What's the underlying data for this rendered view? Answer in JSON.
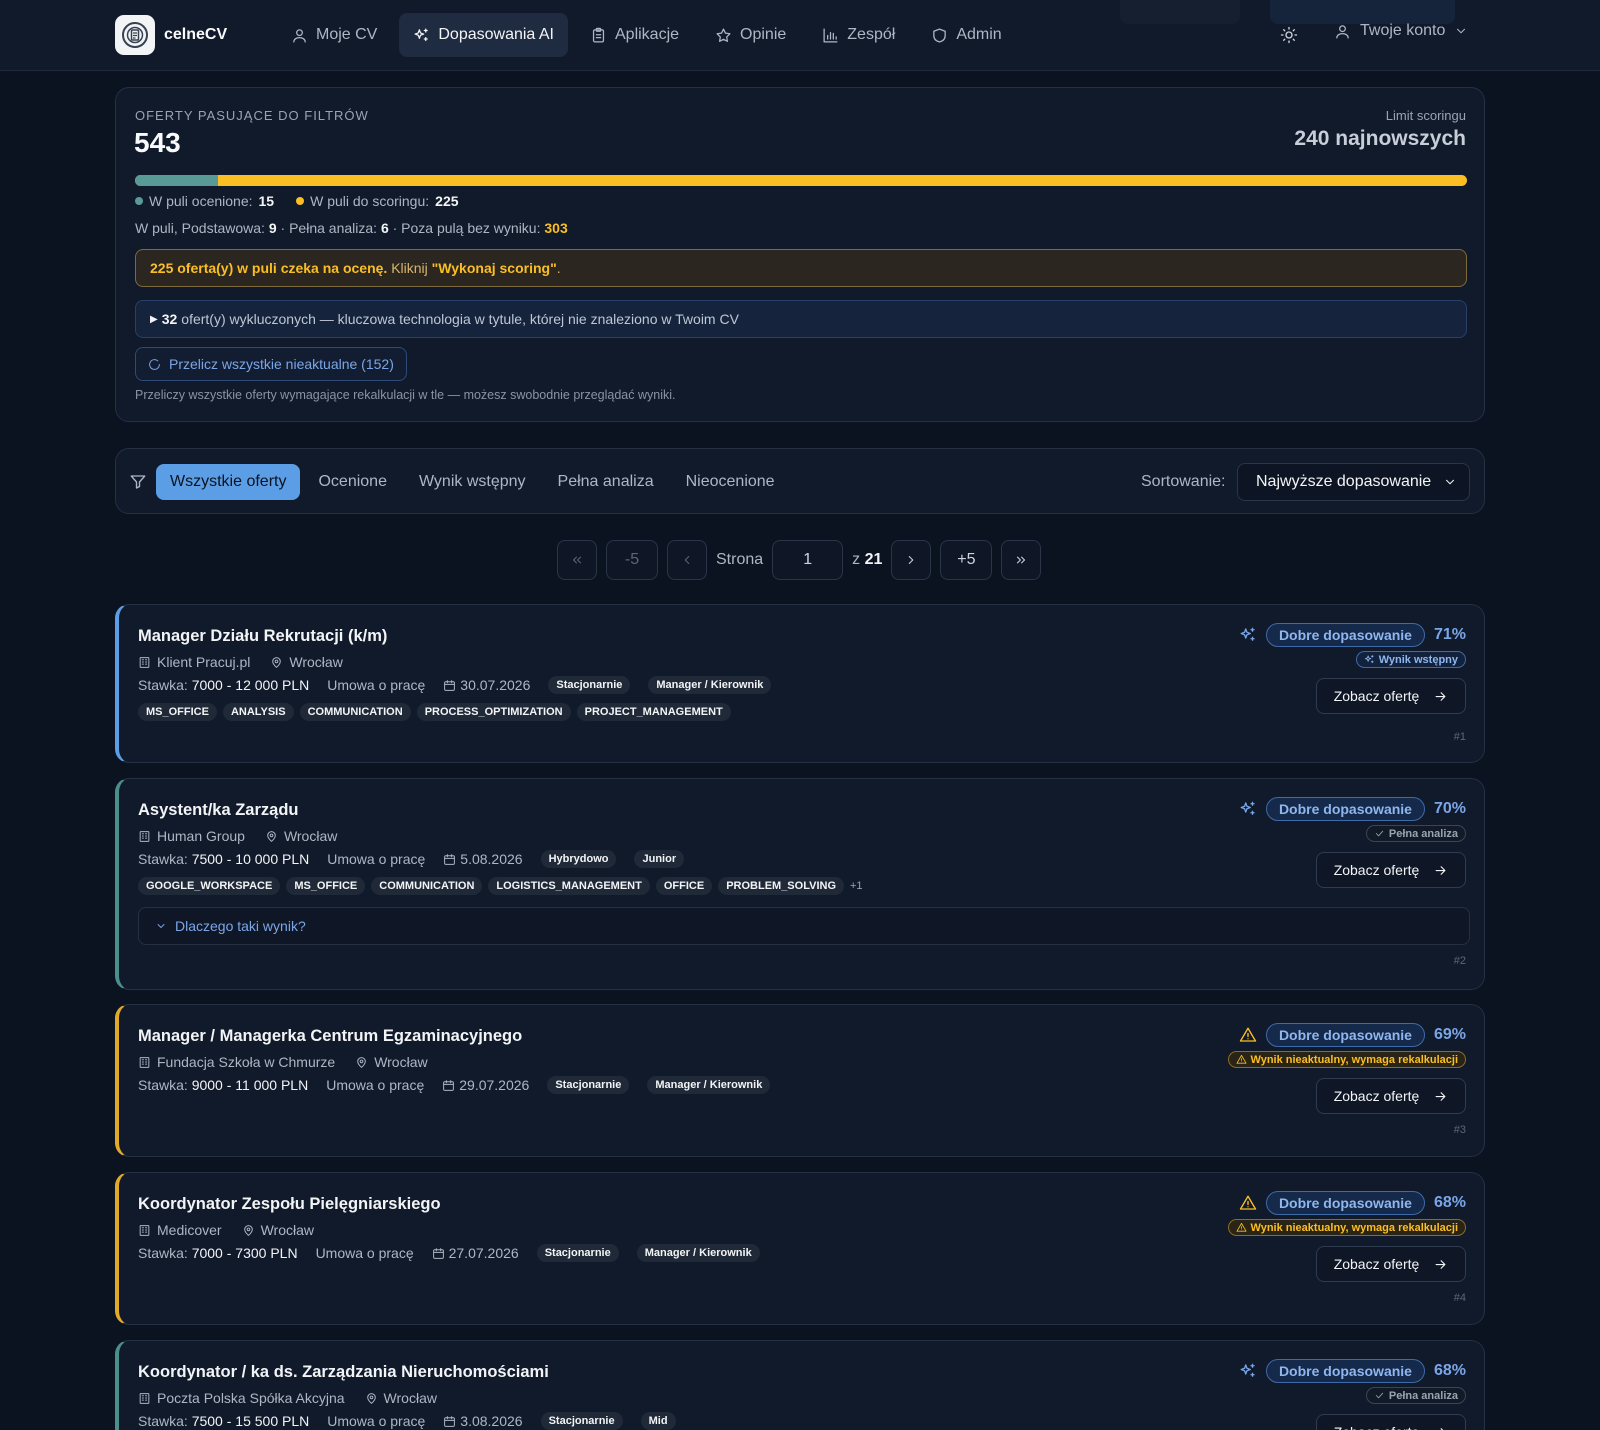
{
  "navbar": {
    "brand": "celneCV",
    "items": [
      {
        "label": "Moje CV",
        "icon": "user-icon",
        "active": false
      },
      {
        "label": "Dopasowania AI",
        "icon": "sparkles-icon",
        "active": true
      },
      {
        "label": "Aplikacje",
        "icon": "clipboard-icon",
        "active": false
      },
      {
        "label": "Opinie",
        "icon": "star-icon",
        "active": false
      },
      {
        "label": "Zespół",
        "icon": "bar-chart-icon",
        "active": false
      },
      {
        "label": "Admin",
        "icon": "shield-icon",
        "active": false
      }
    ],
    "account_label": "Twoje konto"
  },
  "summary": {
    "label": "OFERTY PASUJĄCE DO FILTRÓW",
    "count": "543",
    "limit_label": "Limit scoringu",
    "limit_value": "240 najnowszych",
    "progress_scored_fraction": 0.0625,
    "scored_label": "W puli ocenione:",
    "scored_value": "15",
    "pending_label": "W puli do scoringu:",
    "pending_value": "225",
    "stats_basic_label": "W puli, Podstawowa:",
    "stats_basic_value": "9",
    "stats_full_label": "· Pełna analiza:",
    "stats_full_value": "6",
    "stats_outside_label": "· Poza pulą bez wyniku:",
    "stats_outside_value": "303",
    "warn_bold": "225 oferta(y) w puli czeka na ocenę.",
    "warn_text": "Kliknij",
    "warn_action": "\"Wykonaj scoring\"",
    "warn_end": ".",
    "excluded_count": "32",
    "excluded_text": "ofert(y) wykluczonych — kluczowa technologia w tytule, której nie znaleziono w Twoim CV",
    "recalc_button": "Przelicz wszystkie nieaktualne (152)",
    "recalc_note": "Przeliczy wszystkie oferty wymagające rekalkulacji w tle — możesz swobodnie przeglądać wyniki.",
    "colors": {
      "scored": "#5a9a96",
      "pending": "#fbbf24"
    }
  },
  "filters": {
    "tabs": [
      "Wszystkie oferty",
      "Ocenione",
      "Wynik wstępny",
      "Pełna analiza",
      "Nieocenione"
    ],
    "active_index": 0,
    "sort_label": "Sortowanie:",
    "sort_value": "Najwyższe dopasowanie"
  },
  "pagination": {
    "minus5": "-5",
    "plus5": "+5",
    "page_label": "Strona",
    "current": "1",
    "of_label": "z",
    "total": "21"
  },
  "offers": [
    {
      "title": "Manager Działu Rekrutacji (k/m)",
      "company": "Klient Pracuj.pl",
      "location": "Wrocław",
      "rate_label": "Stawka:",
      "rate": "7000 - 12 000 PLN",
      "contract": "Umowa o pracę",
      "date": "30.07.2026",
      "mode": "Stacjonarnie",
      "level": "Manager / Kierownik",
      "tags": [
        "MS_OFFICE",
        "ANALYSIS",
        "COMMUNICATION",
        "PROCESS_OPTIMIZATION",
        "PROJECT_MANAGEMENT"
      ],
      "more": "",
      "score_label": "Dobre dopasowanie",
      "score_pct": "71%",
      "status": "Wynik wstępny",
      "status_type": "prelim",
      "score_icon": "sparkles-icon",
      "view_button": "Zobacz ofertę",
      "rank": "#1",
      "why": ""
    },
    {
      "title": "Asystent/ka Zarządu",
      "company": "Human Group",
      "location": "Wrocław",
      "rate_label": "Stawka:",
      "rate": "7500 - 10 000 PLN",
      "contract": "Umowa o pracę",
      "date": "5.08.2026",
      "mode": "Hybrydowo",
      "level": "Junior",
      "tags": [
        "GOOGLE_WORKSPACE",
        "MS_OFFICE",
        "COMMUNICATION",
        "LOGISTICS_MANAGEMENT",
        "OFFICE",
        "PROBLEM_SOLVING"
      ],
      "more": "+1",
      "score_label": "Dobre dopasowanie",
      "score_pct": "70%",
      "status": "Pełna analiza",
      "status_type": "full",
      "score_icon": "sparkles-icon",
      "view_button": "Zobacz ofertę",
      "rank": "#2",
      "why": "Dlaczego taki wynik?"
    },
    {
      "title": "Manager / Managerka Centrum Egzaminacyjnego",
      "company": "Fundacja Szkoła w Chmurze",
      "location": "Wrocław",
      "rate_label": "Stawka:",
      "rate": "9000 - 11 000 PLN",
      "contract": "Umowa o pracę",
      "date": "29.07.2026",
      "mode": "Stacjonarnie",
      "level": "Manager / Kierownik",
      "tags": [],
      "more": "",
      "score_label": "Dobre dopasowanie",
      "score_pct": "69%",
      "status": "Wynik nieaktualny, wymaga rekalkulacji",
      "status_type": "stale",
      "score_icon": "warning-icon",
      "view_button": "Zobacz ofertę",
      "rank": "#3",
      "why": ""
    },
    {
      "title": "Koordynator Zespołu Pielęgniarskiego",
      "company": "Medicover",
      "location": "Wrocław",
      "rate_label": "Stawka:",
      "rate": "7000 - 7300 PLN",
      "contract": "Umowa o pracę",
      "date": "27.07.2026",
      "mode": "Stacjonarnie",
      "level": "Manager / Kierownik",
      "tags": [],
      "more": "",
      "score_label": "Dobre dopasowanie",
      "score_pct": "68%",
      "status": "Wynik nieaktualny, wymaga rekalkulacji",
      "status_type": "stale",
      "score_icon": "warning-icon",
      "view_button": "Zobacz ofertę",
      "rank": "#4",
      "why": ""
    },
    {
      "title": "Koordynator / ka ds. Zarządzania Nieruchomościami",
      "company": "Poczta Polska Spółka Akcyjna",
      "location": "Wrocław",
      "rate_label": "Stawka:",
      "rate": "7500 - 15 500 PLN",
      "contract": "Umowa o pracę",
      "date": "3.08.2026",
      "mode": "Stacjonarnie",
      "level": "Mid",
      "tags": [],
      "more": "",
      "score_label": "Dobre dopasowanie",
      "score_pct": "68%",
      "status": "Pełna analiza",
      "status_type": "full",
      "score_icon": "sparkles-icon",
      "view_button": "Zobacz ofertę",
      "rank": "",
      "why": ""
    }
  ]
}
